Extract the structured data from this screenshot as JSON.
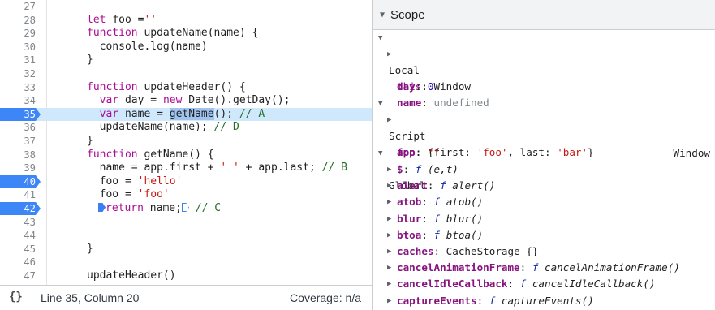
{
  "editor": {
    "lines": [
      {
        "n": "27",
        "bp": false,
        "hl": false
      },
      {
        "n": "28",
        "bp": false,
        "hl": false
      },
      {
        "n": "29",
        "bp": false,
        "hl": false
      },
      {
        "n": "30",
        "bp": false,
        "hl": false
      },
      {
        "n": "31",
        "bp": false,
        "hl": false
      },
      {
        "n": "32",
        "bp": false,
        "hl": false
      },
      {
        "n": "33",
        "bp": false,
        "hl": false
      },
      {
        "n": "34",
        "bp": false,
        "hl": false
      },
      {
        "n": "35",
        "bp": true,
        "hl": true
      },
      {
        "n": "36",
        "bp": false,
        "hl": false
      },
      {
        "n": "37",
        "bp": false,
        "hl": false
      },
      {
        "n": "38",
        "bp": false,
        "hl": false
      },
      {
        "n": "39",
        "bp": false,
        "hl": false
      },
      {
        "n": "40",
        "bp": true,
        "hl": false
      },
      {
        "n": "41",
        "bp": false,
        "hl": false
      },
      {
        "n": "42",
        "bp": true,
        "hl": false
      },
      {
        "n": "43",
        "bp": false,
        "hl": false
      },
      {
        "n": "44",
        "bp": false,
        "hl": false
      },
      {
        "n": "45",
        "bp": false,
        "hl": false
      },
      {
        "n": "46",
        "bp": false,
        "hl": false
      },
      {
        "n": "47",
        "bp": false,
        "hl": false
      }
    ],
    "code": {
      "l28a": "let ",
      "l28b": "foo =",
      "l28c": "''",
      "l29a": "function ",
      "l29b": "updateName(name) {",
      "l30": "  console.log(name)",
      "l31": "}",
      "l33a": "function ",
      "l33b": "updateHeader() {",
      "l34a": "  ",
      "l34b": "var ",
      "l34c": "day = ",
      "l34d": "new ",
      "l34e": "Date().getDay();",
      "l35a": "  ",
      "l35b": "var ",
      "l35c": "name = ",
      "l35d": "getName",
      "l35e": "(); ",
      "l35f": "// A",
      "l36a": "  updateName(name); ",
      "l36b": "// D",
      "l37": "}",
      "l38a": "function ",
      "l38b": "getName() {",
      "l39a": "  name = app.first + ",
      "l39b": "' '",
      "l39c": " + app.last; ",
      "l39d": "// B",
      "l40a": "  foo = ",
      "l40b": "'hello'",
      "l41a": "  foo = ",
      "l41b": "'foo'",
      "l42a": "return ",
      "l42b": "name;",
      "l42c": " // C",
      "l45": "}",
      "l47": "updateHeader()"
    }
  },
  "status": {
    "braces": "{}",
    "position": "Line 35, Column 20",
    "coverage": "Coverage: n/a"
  },
  "scope": {
    "header": "Scope",
    "local": {
      "label": "Local",
      "this_key": "this",
      "this_val": "Window",
      "day_key": "day",
      "day_val": "0",
      "name_key": "name",
      "name_val": "undefined"
    },
    "script": {
      "label": "Script",
      "app_key": "app",
      "app_p1": "{first: ",
      "app_v1": "'foo'",
      "app_p2": ", last: ",
      "app_v2": "'bar'",
      "app_p3": "}",
      "foo_key": "foo",
      "foo_val": "\"\""
    },
    "global": {
      "label": "Global",
      "right": "Window",
      "items": [
        {
          "key": "$",
          "f": "f",
          "sig": "(e,t)"
        },
        {
          "key": "alert",
          "f": "f",
          "sig": "alert()"
        },
        {
          "key": "atob",
          "f": "f",
          "sig": "atob()"
        },
        {
          "key": "blur",
          "f": "f",
          "sig": "blur()"
        },
        {
          "key": "btoa",
          "f": "f",
          "sig": "btoa()"
        },
        {
          "key": "caches",
          "f": "",
          "sig": "CacheStorage {}"
        },
        {
          "key": "cancelAnimationFrame",
          "f": "f",
          "sig": "cancelAnimationFrame()"
        },
        {
          "key": "cancelIdleCallback",
          "f": "f",
          "sig": "cancelIdleCallback()"
        },
        {
          "key": "captureEvents",
          "f": "f",
          "sig": "captureEvents()"
        }
      ]
    }
  }
}
